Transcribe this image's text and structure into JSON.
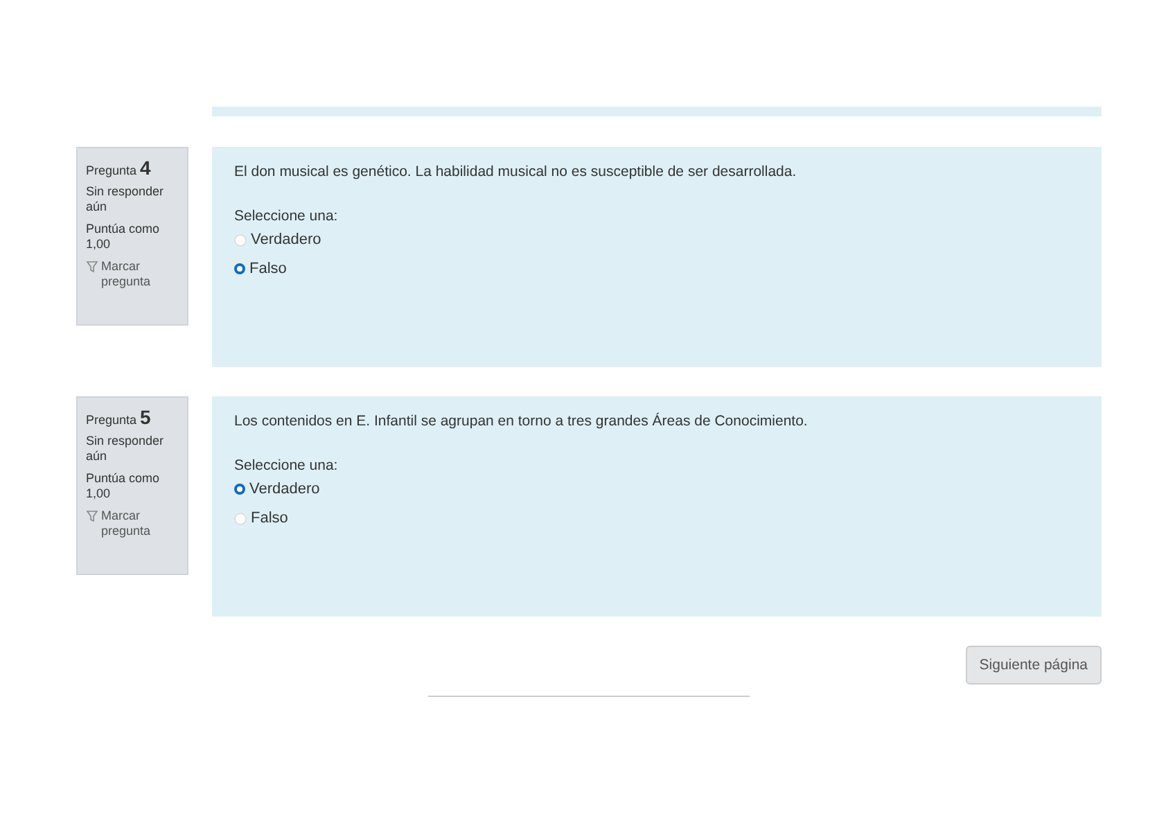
{
  "questions": [
    {
      "label": "Pregunta",
      "number": "4",
      "status": "Sin responder aún",
      "score": "Puntúa como 1,00",
      "flag": "Marcar pregunta",
      "text": "El don musical es genético. La habilidad musical no es susceptible de ser desarrollada.",
      "prompt": "Seleccione una:",
      "options": [
        {
          "label": "Verdadero",
          "selected": false
        },
        {
          "label": "Falso",
          "selected": true
        }
      ]
    },
    {
      "label": "Pregunta",
      "number": "5",
      "status": "Sin responder aún",
      "score": "Puntúa como 1,00",
      "flag": "Marcar pregunta",
      "text": "Los contenidos en E. Infantil se agrupan en torno a tres grandes Áreas de Conocimiento.",
      "prompt": "Seleccione una:",
      "options": [
        {
          "label": "Verdadero",
          "selected": true
        },
        {
          "label": "Falso",
          "selected": false
        }
      ]
    }
  ],
  "next_button": "Siguiente página"
}
